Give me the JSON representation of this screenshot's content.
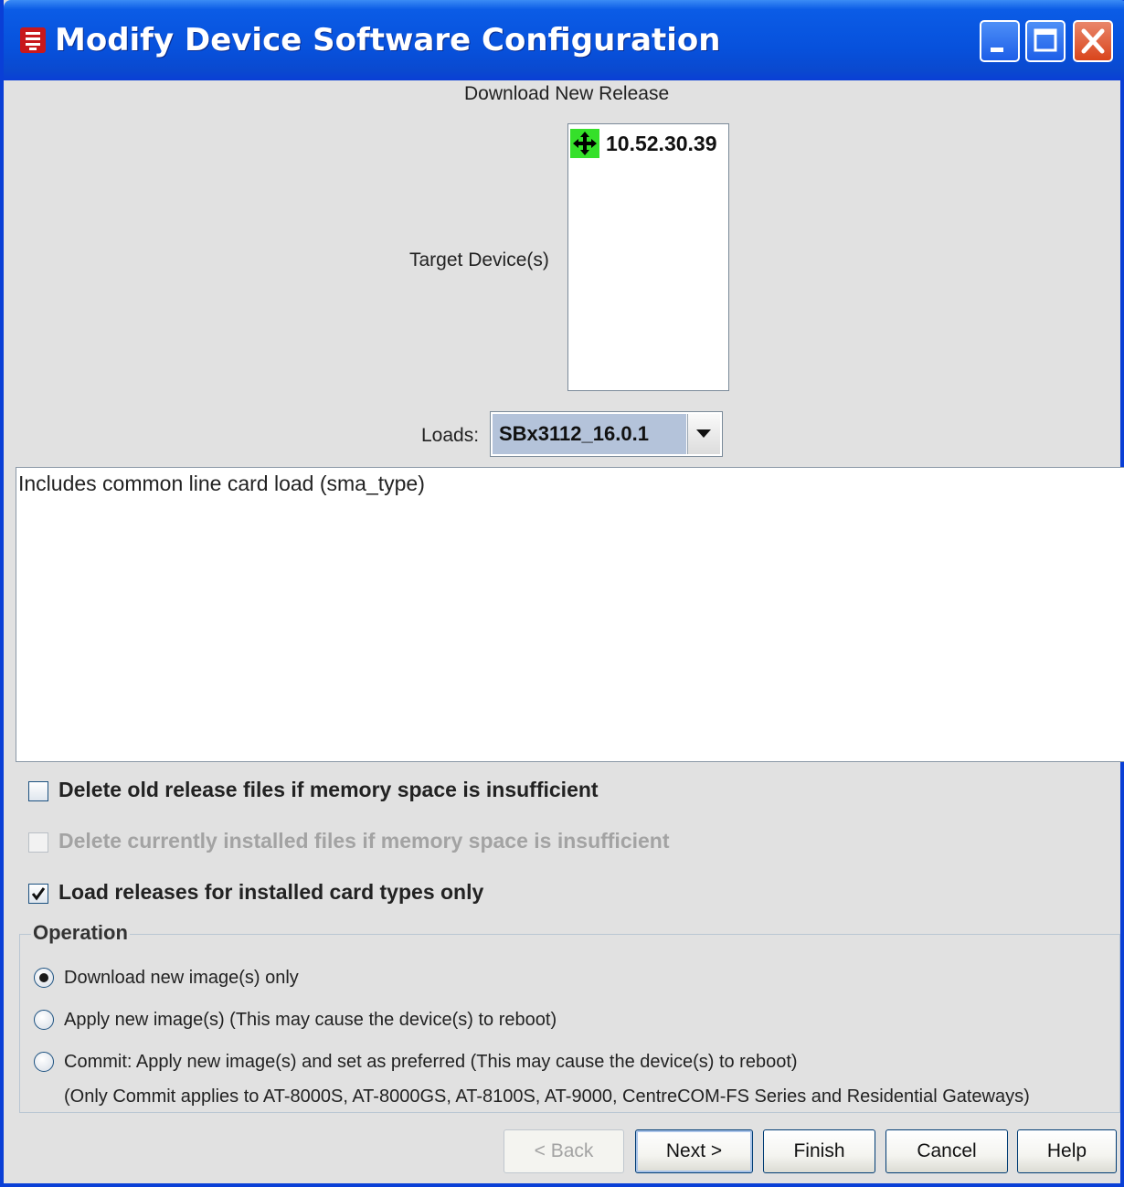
{
  "window": {
    "title": "Modify Device Software Configuration",
    "controls": [
      "minimize-icon",
      "maximize-icon",
      "close-icon"
    ]
  },
  "header": {
    "section_title": "Download New Release"
  },
  "targets": {
    "label": "Target Device(s)",
    "devices": [
      {
        "name": "10.52.30.39",
        "icon": "device-move-icon"
      }
    ]
  },
  "loads": {
    "label": "Loads:",
    "selected": "SBx3112_16.0.1"
  },
  "description": {
    "text": "Includes common line card load (sma_type)"
  },
  "options": {
    "delete_old": {
      "label": "Delete old release files if memory space is insufficient",
      "checked": false,
      "enabled": true
    },
    "delete_current": {
      "label": "Delete currently installed files if memory space is insufficient",
      "checked": false,
      "enabled": false
    },
    "installed_only": {
      "label": "Load releases for installed card types only",
      "checked": true,
      "enabled": true
    }
  },
  "operation": {
    "title": "Operation",
    "choices": [
      {
        "label": "Download new image(s) only",
        "selected": true
      },
      {
        "label": "Apply new image(s)  (This may cause the device(s) to reboot)",
        "selected": false
      },
      {
        "label": "Commit: Apply new image(s) and set as preferred (This may cause the device(s) to reboot)",
        "selected": false
      }
    ],
    "note": "(Only Commit applies to AT-8000S, AT-8000GS, AT-8100S, AT-9000, CentreCOM-FS Series and Residential Gateways)"
  },
  "buttons": {
    "back": "< Back",
    "next": "Next >",
    "finish": "Finish",
    "cancel": "Cancel",
    "help": "Help"
  },
  "colors": {
    "titlebar": "#0751dc",
    "panel": "#e1e1e1",
    "selection": "#b4c3da",
    "device_icon_bg": "#35e02a"
  }
}
